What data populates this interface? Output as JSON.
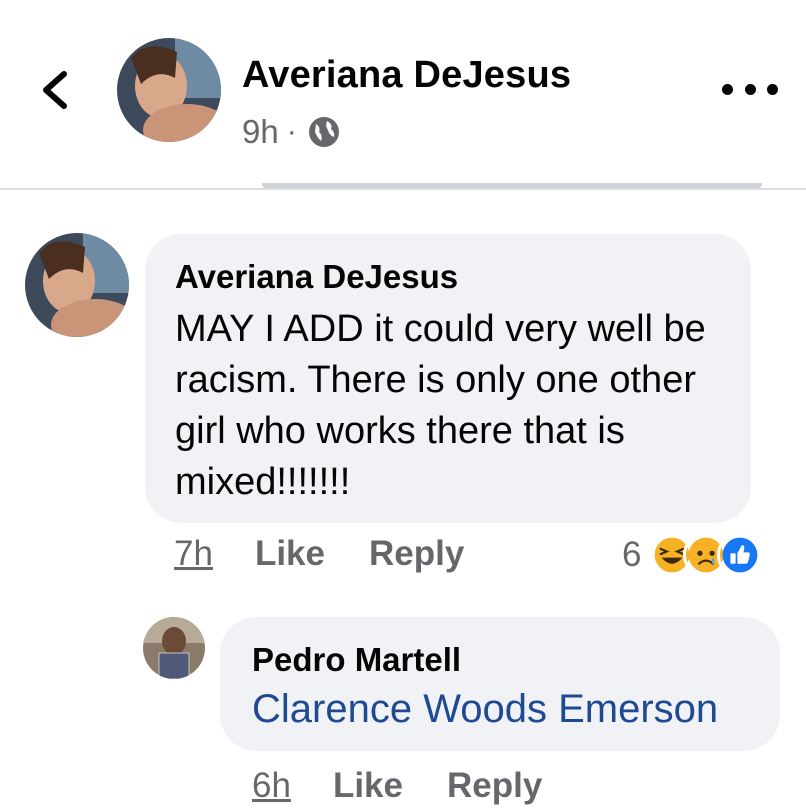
{
  "header": {
    "author_name": "Averiana DeJesus",
    "time": "9h",
    "separator": "·",
    "privacy_icon": "globe-icon",
    "back_icon": "chevron-left-icon",
    "more_icon": "more-dots-icon"
  },
  "comments": [
    {
      "author": "Averiana DeJesus",
      "text": "MAY I ADD it could very well be racism. There is only one other girl who works there that is mixed!!!!!!!",
      "time": "7h",
      "like_label": "Like",
      "reply_label": "Reply",
      "reaction_count": "6",
      "reaction_icons": [
        "laughing-emoji-icon",
        "sad-emoji-icon",
        "like-thumb-icon"
      ]
    }
  ],
  "replies": [
    {
      "author": "Pedro Martell",
      "mention": "Clarence Woods Emerson",
      "time": "6h",
      "like_label": "Like",
      "reply_label": "Reply"
    }
  ],
  "colors": {
    "bubble": "#f0f2f5",
    "secondary_text": "#65676b",
    "mention_link": "#1f4a91",
    "like_blue": "#1877f2"
  }
}
